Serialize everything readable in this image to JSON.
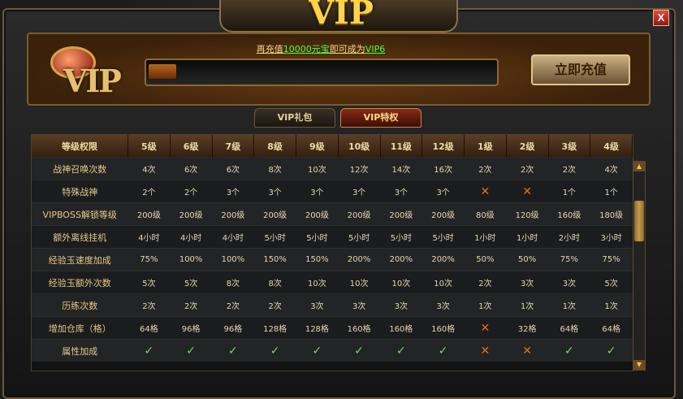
{
  "window": {
    "title": "VIP",
    "close_label": "X"
  },
  "header": {
    "vip_label": "VIP",
    "tip_prefix": "再充值",
    "tip_amount": "10000元宝",
    "tip_middle": "即可成为",
    "tip_target": "VIP6",
    "progress": 0.08,
    "recharge_button": "立即充值"
  },
  "tabs": [
    {
      "label": "VIP礼包",
      "active": false
    },
    {
      "label": "VIP特权",
      "active": true
    }
  ],
  "table": {
    "header_label": "等级权限",
    "columns": [
      "5级",
      "6级",
      "7级",
      "8级",
      "9级",
      "10级",
      "11级",
      "12级",
      "1级",
      "2级",
      "3级",
      "4级"
    ],
    "rows": [
      {
        "label": "战神召唤次数",
        "cells": [
          "4次",
          "6次",
          "6次",
          "8次",
          "10次",
          "12次",
          "14次",
          "16次",
          "2次",
          "2次",
          "2次",
          "4次"
        ]
      },
      {
        "label": "特殊战神",
        "cells": [
          "2个",
          "2个",
          "3个",
          "3个",
          "3个",
          "3个",
          "3个",
          "3个",
          "✕",
          "✕",
          "1个",
          "1个"
        ]
      },
      {
        "label": "VIPBOSS解锁等级",
        "cells": [
          "200级",
          "200级",
          "200级",
          "200级",
          "200级",
          "200级",
          "200级",
          "200级",
          "80级",
          "120级",
          "160级",
          "180级"
        ]
      },
      {
        "label": "额外离线挂机",
        "cells": [
          "4小时",
          "4小时",
          "4小时",
          "5小时",
          "5小时",
          "5小时",
          "5小时",
          "5小时",
          "1小时",
          "1小时",
          "2小时",
          "3小时"
        ]
      },
      {
        "label": "经验玉速度加成",
        "cells": [
          "75%",
          "100%",
          "100%",
          "150%",
          "150%",
          "200%",
          "200%",
          "200%",
          "50%",
          "50%",
          "75%",
          "75%"
        ]
      },
      {
        "label": "经验玉额外次数",
        "cells": [
          "5次",
          "5次",
          "8次",
          "8次",
          "10次",
          "10次",
          "10次",
          "10次",
          "2次",
          "3次",
          "3次",
          "5次"
        ]
      },
      {
        "label": "历练次数",
        "cells": [
          "2次",
          "2次",
          "2次",
          "2次",
          "3次",
          "3次",
          "3次",
          "3次",
          "1次",
          "1次",
          "1次",
          "1次"
        ]
      },
      {
        "label": "增加仓库（格）",
        "cells": [
          "64格",
          "96格",
          "96格",
          "128格",
          "128格",
          "160格",
          "160格",
          "160格",
          "✕",
          "32格",
          "64格",
          "64格"
        ]
      },
      {
        "label": "属性加成",
        "cells": [
          "✓",
          "✓",
          "✓",
          "✓",
          "✓",
          "✓",
          "✓",
          "✓",
          "✕",
          "✕",
          "✓",
          "✓"
        ]
      }
    ]
  },
  "scrollbar": {
    "up_label": "▲",
    "down_label": "▼"
  }
}
